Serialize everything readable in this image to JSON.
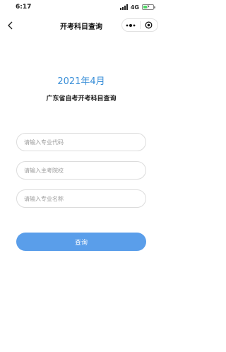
{
  "status_bar": {
    "time": "6:17",
    "network": "4G",
    "battery_level": 0.4
  },
  "nav": {
    "title": "开考科目查询"
  },
  "content": {
    "headline": "2021年4月",
    "subtitle": "广东省自考开考科目查询"
  },
  "form": {
    "fields": [
      {
        "value": "",
        "placeholder": "请输入专业代码"
      },
      {
        "value": "",
        "placeholder": "请输入主考院校"
      },
      {
        "value": "",
        "placeholder": "请输入专业名称"
      }
    ],
    "submit_label": "查询"
  },
  "colors": {
    "accent": "#3a8fd8",
    "button": "#5a9eea"
  }
}
